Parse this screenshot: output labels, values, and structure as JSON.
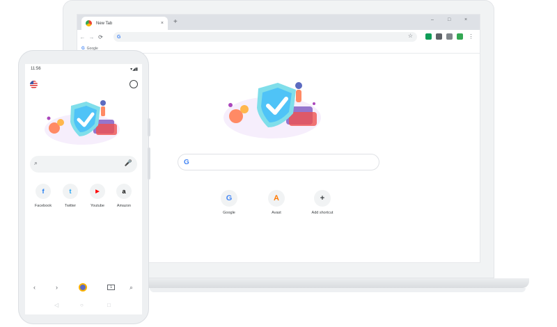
{
  "laptop": {
    "tab_title": "New Tab",
    "tab_close": "×",
    "new_tab": "+",
    "window_controls": [
      "–",
      "□",
      "×"
    ],
    "nav_buttons": [
      "←",
      "→",
      "⟳"
    ],
    "omnibox_logo": "G",
    "bookmark_star": "☆",
    "bookmark_label": "Google",
    "bookmark_logo": "G",
    "search_logo": "G",
    "shortcuts": [
      {
        "label": "Google",
        "glyph": "G",
        "color": "#4285f4"
      },
      {
        "label": "Avast",
        "glyph": "A",
        "color": "#ff7800"
      },
      {
        "label": "Add shortcut",
        "glyph": "+",
        "color": "#3c4043"
      }
    ]
  },
  "phone": {
    "time": "11:56",
    "status_icons": "▾◢▮",
    "search_icon": "⌕",
    "mic_icon": "🎤",
    "tiles": [
      {
        "label": "Facebook",
        "glyph": "f",
        "color": "#1877f2"
      },
      {
        "label": "Twitter",
        "glyph": "t",
        "color": "#1da1f2"
      },
      {
        "label": "Youtube",
        "glyph": "▶",
        "color": "#ff0000"
      },
      {
        "label": "Amazon",
        "glyph": "a",
        "color": "#000000"
      }
    ],
    "bottom_bar": [
      "‹",
      "›",
      "1",
      "⌕"
    ],
    "system_nav": [
      "◁",
      "○",
      "□"
    ]
  },
  "colors": {
    "accent": "#4285f4",
    "shield_light": "#a7e3f2",
    "shield_dark": "#4fb3d9",
    "warm": "#ff8a65",
    "purple": "#7e57c2"
  }
}
